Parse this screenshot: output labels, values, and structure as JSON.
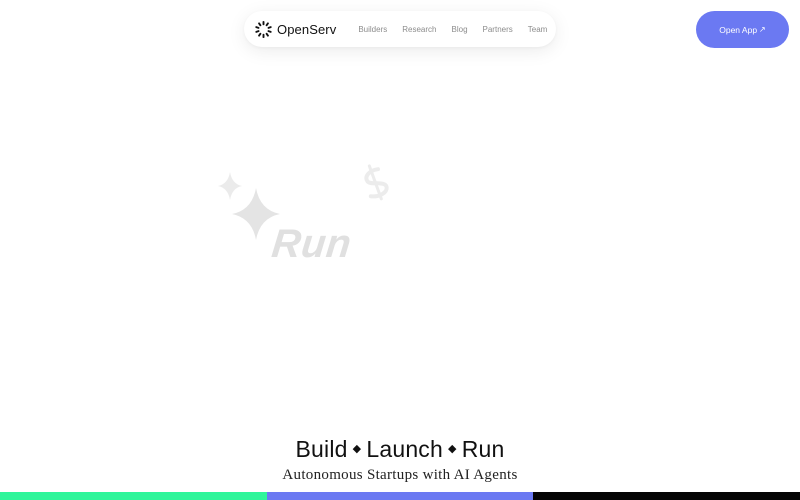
{
  "brand": {
    "name": "OpenServ",
    "icon": "openserv-logo-icon"
  },
  "nav": {
    "links": [
      {
        "label": "Builders"
      },
      {
        "label": "Research"
      },
      {
        "label": "Blog"
      },
      {
        "label": "Partners"
      },
      {
        "label": "Team"
      }
    ]
  },
  "cta": {
    "label": "Open App",
    "icon": "arrow-up-right-icon",
    "color": "#6b79f2"
  },
  "hero": {
    "animated_word": "Run",
    "icons": [
      "sparkle-icon",
      "small-sparkle-icon",
      "dollar-icon"
    ]
  },
  "tagline": {
    "words": [
      "Build",
      "Launch",
      "Run"
    ],
    "separator": "◆",
    "subtitle": "Autonomous Startups with AI Agents"
  },
  "colors": {
    "bar_segments": [
      "#2ff59a",
      "#6b79f2",
      "#050505"
    ],
    "faded_graphic": "#e0e0e0"
  }
}
